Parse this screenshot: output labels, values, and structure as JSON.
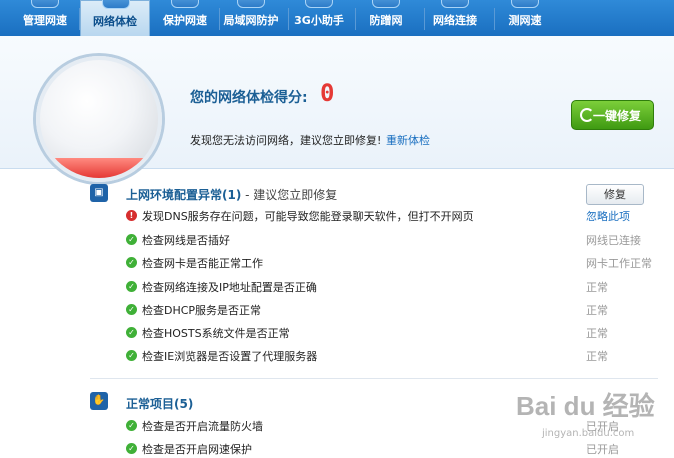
{
  "tabs": [
    {
      "label": "管理网速",
      "active": false
    },
    {
      "label": "网络体检",
      "active": true
    },
    {
      "label": "保护网速",
      "active": false
    },
    {
      "label": "局域网防护",
      "active": false
    },
    {
      "label": "3G小助手",
      "active": false
    },
    {
      "label": "防蹭网",
      "active": false
    },
    {
      "label": "网络连接",
      "active": false
    },
    {
      "label": "测网速",
      "active": false
    }
  ],
  "header": {
    "score_label": "您的网络体检得分:",
    "score_value": "0",
    "status_message": "发现您无法访问网络，建议您立即修复!",
    "recheck_link": "重新体检",
    "fix_all_button": "一键修复"
  },
  "sections": [
    {
      "title": "上网环境配置异常(1)",
      "subtitle": " - 建议您立即修复",
      "action_button": "修复",
      "items": [
        {
          "text": "发现DNS服务存在问题，可能导致您能登录聊天软件，但打不开网页",
          "status": "忽略此项",
          "state": "error"
        },
        {
          "text": "检查网线是否插好",
          "status": "网线已连接",
          "state": "ok"
        },
        {
          "text": "检查网卡是否能正常工作",
          "status": "网卡工作正常",
          "state": "ok"
        },
        {
          "text": "检查网络连接及IP地址配置是否正确",
          "status": "正常",
          "state": "ok"
        },
        {
          "text": "检查DHCP服务是否正常",
          "status": "正常",
          "state": "ok"
        },
        {
          "text": "检查HOSTS系统文件是否正常",
          "status": "正常",
          "state": "ok"
        },
        {
          "text": "检查IE浏览器是否设置了代理服务器",
          "status": "正常",
          "state": "ok"
        }
      ]
    },
    {
      "title": "正常项目(5)",
      "items": [
        {
          "text": "检查是否开启流量防火墙",
          "status": "已开启",
          "state": "ok"
        },
        {
          "text": "检查是否开启网速保护",
          "status": "已开启",
          "state": "ok"
        }
      ]
    }
  ],
  "watermark": {
    "brand": "Bai du 经验",
    "url": "jingyan.baidu.com"
  },
  "colors": {
    "accent": "#1a6fc0",
    "ok": "#3fb037",
    "error": "#d62e2e",
    "score": "#e53935",
    "fix_button": "#4caf1a"
  }
}
